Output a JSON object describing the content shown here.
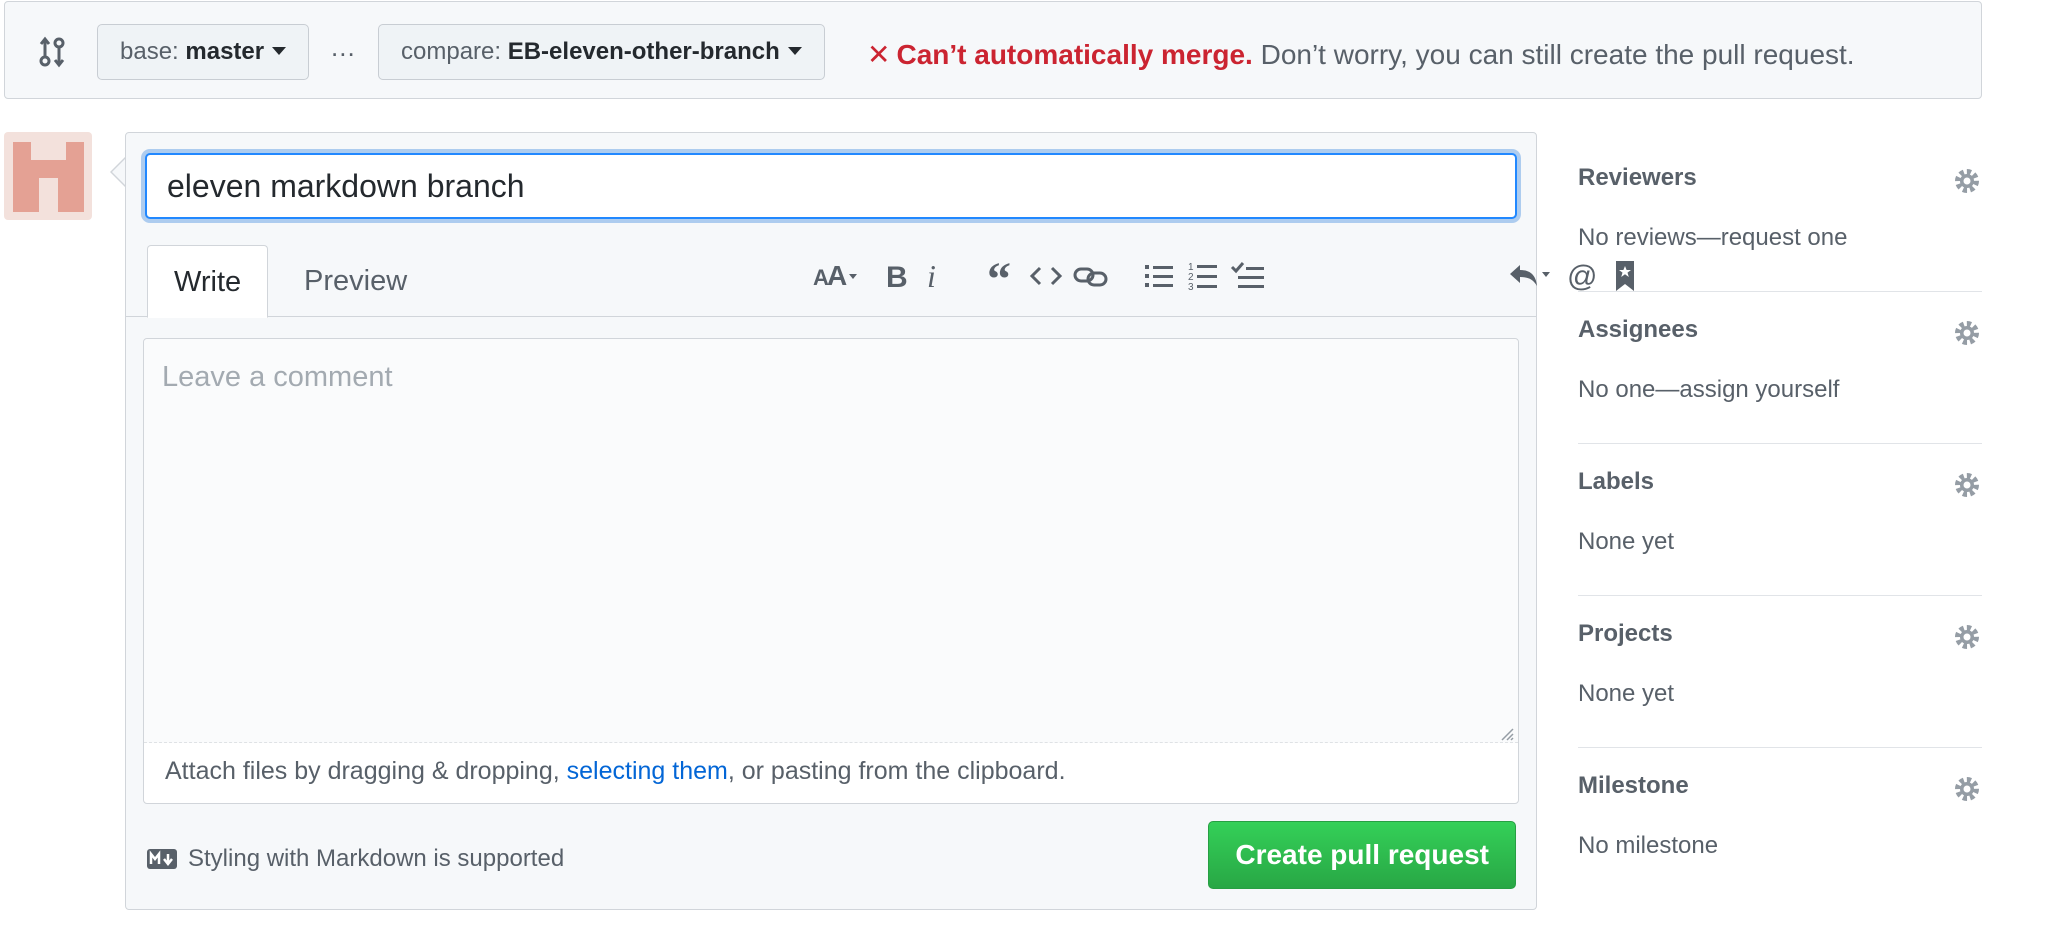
{
  "range": {
    "base_prefix": "base:",
    "base_branch": "master",
    "ellipsis": "...",
    "compare_prefix": "compare:",
    "compare_branch": "EB-eleven-other-branch",
    "merge_icon": "x-icon",
    "merge_status": "Can’t automatically merge.",
    "merge_note": "Don’t worry, you can still create the pull request."
  },
  "composer": {
    "title_value": "eleven markdown branch",
    "tabs": [
      {
        "label": "Write",
        "active": true
      },
      {
        "label": "Preview",
        "active": false
      }
    ],
    "toolbar": [
      "header-text-icon",
      "bold-icon",
      "italic-icon",
      "quote-icon",
      "code-icon",
      "link-icon",
      "unordered-list-icon",
      "ordered-list-icon",
      "task-list-icon",
      "reply-icon",
      "mention-icon",
      "bookmark-icon"
    ],
    "comment_placeholder": "Leave a comment",
    "attach_prefix": "Attach files by dragging & dropping, ",
    "attach_link": "selecting them",
    "attach_suffix": ", or pasting from the clipboard.",
    "markdown_note": "Styling with Markdown is supported",
    "create_label": "Create pull request"
  },
  "sidebar": [
    {
      "title": "Reviewers",
      "value": "No reviews—request one"
    },
    {
      "title": "Assignees",
      "value": "No one—assign yourself"
    },
    {
      "title": "Labels",
      "value": "None yet"
    },
    {
      "title": "Projects",
      "value": "None yet"
    },
    {
      "title": "Milestone",
      "value": "No milestone"
    }
  ],
  "colors": {
    "error": "#cb2431",
    "link": "#0366d6",
    "create_button": "#28a745",
    "focus_border": "#2188ff"
  }
}
